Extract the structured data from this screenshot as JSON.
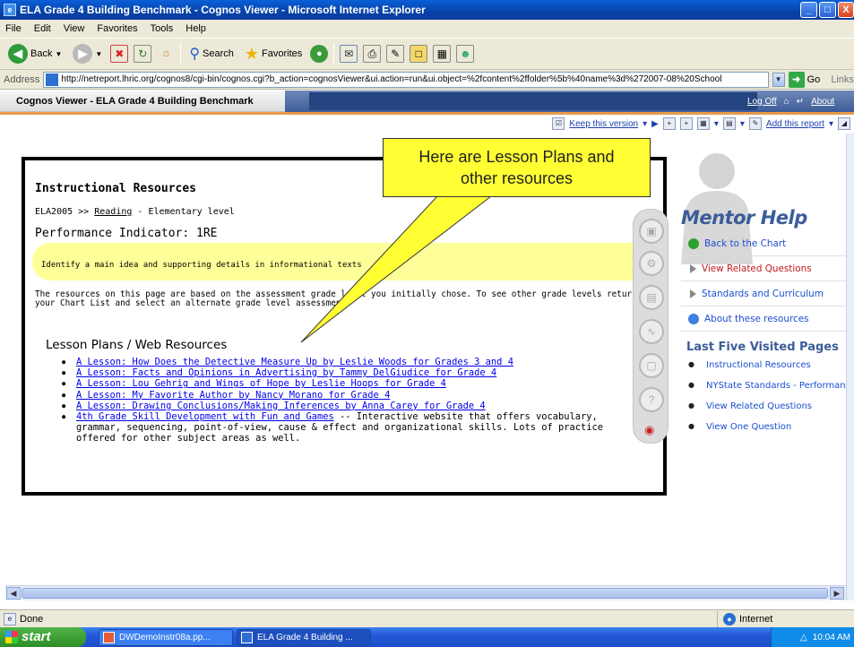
{
  "window": {
    "title": "ELA Grade 4 Building Benchmark - Cognos Viewer - Microsoft Internet Explorer",
    "minimize_label": "_",
    "maximize_label": "□",
    "close_label": "X"
  },
  "menu": [
    "File",
    "Edit",
    "View",
    "Favorites",
    "Tools",
    "Help"
  ],
  "toolbar": {
    "back_label": "Back",
    "search_label": "Search",
    "favorites_label": "Favorites"
  },
  "address": {
    "label": "Address",
    "url": "http://netreport.lhric.org/cognos8/cgi-bin/cognos.cgi?b_action=cognosViewer&ui.action=run&ui.object=%2fcontent%2ffolder%5b%40name%3d%272007-08%20School",
    "go_label": "Go",
    "links_label": "Links"
  },
  "cognos": {
    "title": "Cognos Viewer - ELA Grade 4 Building Benchmark",
    "logoff_label": "Log Off",
    "about_label": "About",
    "keep_version_label": "Keep this version",
    "add_report_label": "Add this report"
  },
  "report": {
    "section_title": "Instructional Resources",
    "breadcrumb_prefix": "ELA2005 >> ",
    "breadcrumb_link": "Reading",
    "breadcrumb_suffix": " - Elementary level",
    "pi_title": "Performance Indicator: 1RE",
    "pi_text": "Identify a main idea and supporting details in informational texts",
    "intro": "The resources on this page are based on the assessment grade level you initially chose. To see other grade levels return to your Chart List and select an alternate grade level assessment.",
    "lp_heading": "Lesson Plans / Web Resources",
    "lessons": [
      {
        "link": "A Lesson: How Does the Detective Measure Up by Leslie Woods for Grades 3 and 4",
        "desc": ""
      },
      {
        "link": "A Lesson: Facts and Opinions in Advertising by Tammy DelGiudice for Grade 4",
        "desc": ""
      },
      {
        "link": "A Lesson: Lou Gehrig and Wings of Hope by Leslie Hoops for Grade 4",
        "desc": ""
      },
      {
        "link": "A Lesson: My Favorite Author by Nancy Morano for Grade 4",
        "desc": ""
      },
      {
        "link": "A Lesson: Drawing Conclusions/Making Inferences by Anna Carey for Grade 4",
        "desc": ""
      },
      {
        "link": "4th Grade Skill Development with Fun and Games",
        "desc": " -- Interactive website that offers vocabulary, grammar, sequencing, point-of-view, cause & effect and organizational skills. Lots of practice offered for other subject areas as well."
      }
    ]
  },
  "callout": {
    "line1": "Here are Lesson Plans and",
    "line2": "other resources"
  },
  "mentor": {
    "title": "Mentor Help",
    "menu": [
      {
        "label": "Back to the Chart",
        "icon": "green-play-icon"
      },
      {
        "label": "View Related Questions",
        "icon": "grey-triangle-icon",
        "active": true
      },
      {
        "label": "Standards and Curriculum",
        "icon": "grey-triangle-icon"
      },
      {
        "label": "About these resources",
        "icon": "blue-info-icon"
      }
    ],
    "visited_title": "Last Five Visited Pages",
    "visited": [
      "Instructional Resources",
      "NYState Standards - Performance",
      "View Related Questions",
      "View One Question"
    ]
  },
  "status": {
    "text": "Done",
    "zone": "Internet"
  },
  "taskbar": {
    "start_label": "start",
    "tasks": [
      "DWDemoInstr08a.pp...",
      "ELA Grade 4 Building ..."
    ],
    "clock": "10:04 AM"
  },
  "colors": {
    "callout_fill": "#ffff33",
    "pi_highlight": "#ffff99",
    "link": "#0000ee",
    "mentor_blue": "#3b5d99"
  }
}
